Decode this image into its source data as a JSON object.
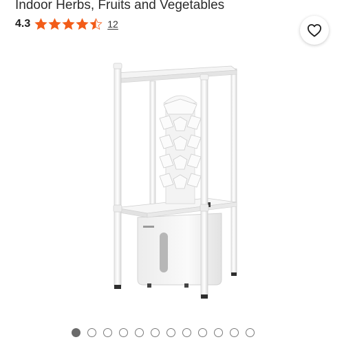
{
  "product": {
    "title": "Indoor Herbs, Fruits and Vegetables",
    "rating": {
      "value": "4.3",
      "stars": [
        1,
        1,
        1,
        1,
        0.5
      ],
      "review_count": "12"
    },
    "favorite_icon": "heart-outline-icon"
  },
  "gallery": {
    "total_images": 12,
    "active_index": 0
  },
  "colors": {
    "star": "#f25c19",
    "star_empty": "#d8d8d8",
    "dot_active": "#6b6b6b",
    "dot_border": "#7a7a7a"
  }
}
